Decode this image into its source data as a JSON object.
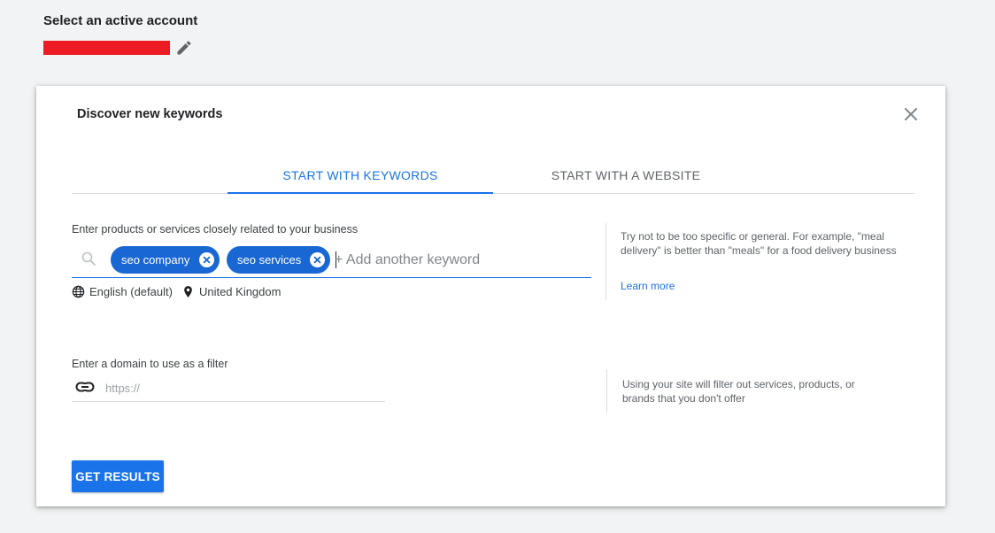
{
  "account": {
    "title": "Select an active account",
    "redaction_color": "#ed1c24",
    "edit_icon": "pencil-icon"
  },
  "dialog": {
    "title": "Discover new keywords",
    "close_icon": "close-icon",
    "tabs": [
      {
        "label": "START WITH KEYWORDS",
        "active": true
      },
      {
        "label": "START WITH A WEBSITE",
        "active": false
      }
    ],
    "keywords": {
      "label": "Enter products or services closely related to your business",
      "chips": [
        "seo company",
        "seo services"
      ],
      "placeholder": "+ Add another keyword",
      "language": "English (default)",
      "location": "United Kingdom",
      "hint": "Try not to be too specific or general. For example, \"meal delivery\" is better than \"meals\" for a food delivery business",
      "learn_more": "Learn more"
    },
    "domain": {
      "label": "Enter a domain to use as a filter",
      "placeholder": "https://",
      "hint": "Using your site will filter out services, products, or brands that you don't offer"
    },
    "submit_label": "GET RESULTS"
  },
  "colors": {
    "accent": "#1a73e8",
    "chip": "#1967d2",
    "background": "#f1f3f4"
  }
}
